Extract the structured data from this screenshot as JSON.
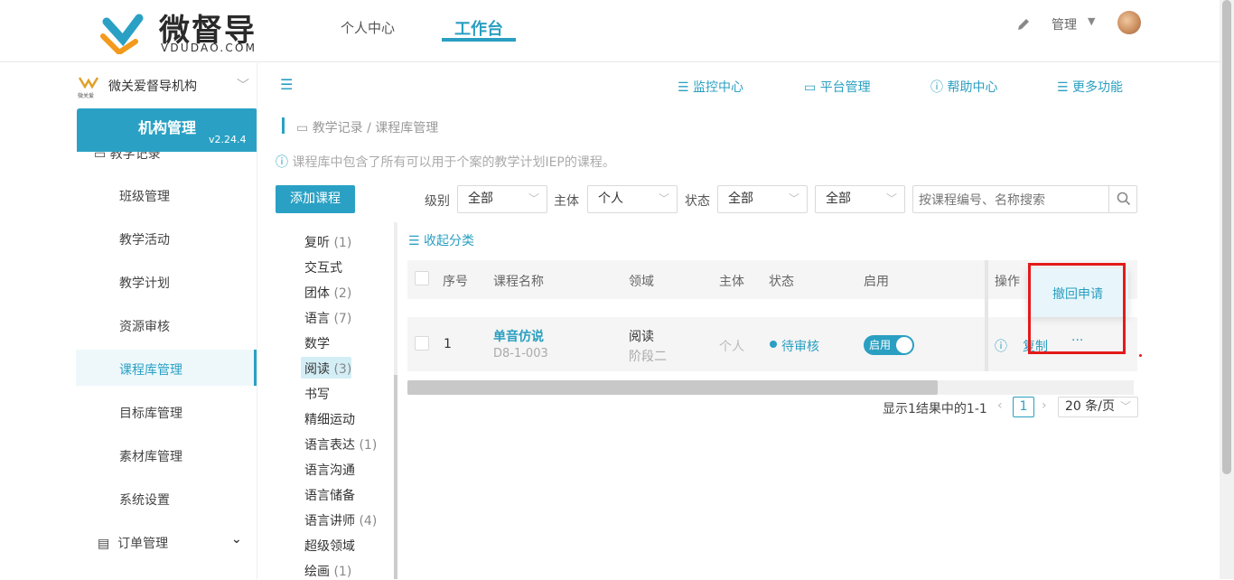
{
  "brand": {
    "name": "微督导",
    "domain": "VDUDAO.COM",
    "color": "#2a9fc1"
  },
  "header": {
    "tabs": [
      {
        "label": "个人中心",
        "active": false
      },
      {
        "label": "工作台",
        "active": true
      }
    ],
    "edit_icon": "pencil-icon",
    "user_menu": "管理"
  },
  "sidebar": {
    "org_name": "微关爱督导机构",
    "org_logo_text": "微关爱",
    "section_title": "机构管理",
    "version": "v2.24.4",
    "partial_item": "教学记录",
    "items": [
      {
        "label": "班级管理",
        "active": false
      },
      {
        "label": "教学活动",
        "active": false
      },
      {
        "label": "教学计划",
        "active": false
      },
      {
        "label": "资源审核",
        "active": false
      },
      {
        "label": "课程库管理",
        "active": true
      },
      {
        "label": "目标库管理",
        "active": false
      },
      {
        "label": "素材库管理",
        "active": false
      },
      {
        "label": "系统设置",
        "active": false
      }
    ],
    "order_menu": "订单管理"
  },
  "toolbar": {
    "links": [
      "监控中心",
      "平台管理",
      "帮助中心",
      "更多功能"
    ]
  },
  "breadcrumb": "教学记录 / 课程库管理",
  "notice": "课程库中包含了所有可以用于个案的教学计划IEP的课程。",
  "filters": {
    "add_button": "添加课程",
    "level_label": "级别",
    "level_value": "全部",
    "subject_label": "主体",
    "subject_value": "个人",
    "status_label": "状态",
    "status_value": "全部",
    "extra_value": "全部",
    "search_placeholder": "按课程编号、名称搜索"
  },
  "categories": [
    {
      "name": "复听",
      "count": "(1)"
    },
    {
      "name": "交互式",
      "count": ""
    },
    {
      "name": "团体",
      "count": "(2)"
    },
    {
      "name": "语言",
      "count": "(7)"
    },
    {
      "name": "数学",
      "count": ""
    },
    {
      "name": "阅读",
      "count": "(3)",
      "active": true
    },
    {
      "name": "书写",
      "count": ""
    },
    {
      "name": "精细运动",
      "count": ""
    },
    {
      "name": "语言表达",
      "count": "(1)"
    },
    {
      "name": "语言沟通",
      "count": ""
    },
    {
      "name": "语言储备",
      "count": ""
    },
    {
      "name": "语言讲师",
      "count": "(4)"
    },
    {
      "name": "超级领域",
      "count": ""
    },
    {
      "name": "绘画",
      "count": "(1)"
    }
  ],
  "table": {
    "collapse_label": "收起分类",
    "headers": [
      "序号",
      "课程名称",
      "领域",
      "主体",
      "状态",
      "启用",
      "操作"
    ],
    "rows": [
      {
        "index": "1",
        "name": "单音仿说",
        "code": "D8-1-003",
        "domain": "阅读",
        "stage": "阶段二",
        "subject": "个人",
        "status": "待审核",
        "enabled_label": "启用",
        "copy": "复制",
        "more": "···"
      }
    ]
  },
  "popover": {
    "label": "撤回申请"
  },
  "pagination": {
    "summary": "显示1结果中的1-1",
    "current": "1",
    "page_size": "20 条/页"
  }
}
